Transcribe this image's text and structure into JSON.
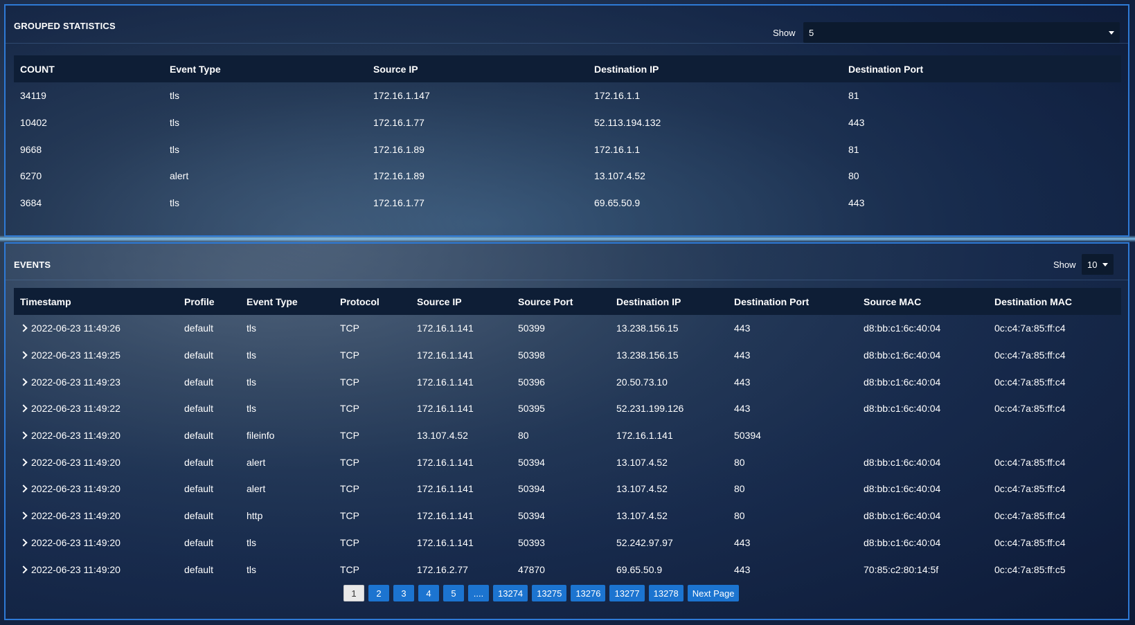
{
  "stats": {
    "title": "GROUPED STATISTICS",
    "show_label": "Show",
    "show_value": "5",
    "columns": [
      "COUNT",
      "Event Type",
      "Source IP",
      "Destination IP",
      "Destination Port"
    ],
    "rows": [
      [
        "34119",
        "tls",
        "172.16.1.147",
        "172.16.1.1",
        "81"
      ],
      [
        "10402",
        "tls",
        "172.16.1.77",
        "52.113.194.132",
        "443"
      ],
      [
        "9668",
        "tls",
        "172.16.1.89",
        "172.16.1.1",
        "81"
      ],
      [
        "6270",
        "alert",
        "172.16.1.89",
        "13.107.4.52",
        "80"
      ],
      [
        "3684",
        "tls",
        "172.16.1.77",
        "69.65.50.9",
        "443"
      ]
    ]
  },
  "events": {
    "title": "EVENTS",
    "show_label": "Show",
    "show_value": "10",
    "columns": [
      "Timestamp",
      "Profile",
      "Event Type",
      "Protocol",
      "Source IP",
      "Source Port",
      "Destination IP",
      "Destination Port",
      "Source MAC",
      "Destination MAC"
    ],
    "rows": [
      [
        "2022-06-23 11:49:26",
        "default",
        "tls",
        "TCP",
        "172.16.1.141",
        "50399",
        "13.238.156.15",
        "443",
        "d8:bb:c1:6c:40:04",
        "0c:c4:7a:85:ff:c4"
      ],
      [
        "2022-06-23 11:49:25",
        "default",
        "tls",
        "TCP",
        "172.16.1.141",
        "50398",
        "13.238.156.15",
        "443",
        "d8:bb:c1:6c:40:04",
        "0c:c4:7a:85:ff:c4"
      ],
      [
        "2022-06-23 11:49:23",
        "default",
        "tls",
        "TCP",
        "172.16.1.141",
        "50396",
        "20.50.73.10",
        "443",
        "d8:bb:c1:6c:40:04",
        "0c:c4:7a:85:ff:c4"
      ],
      [
        "2022-06-23 11:49:22",
        "default",
        "tls",
        "TCP",
        "172.16.1.141",
        "50395",
        "52.231.199.126",
        "443",
        "d8:bb:c1:6c:40:04",
        "0c:c4:7a:85:ff:c4"
      ],
      [
        "2022-06-23 11:49:20",
        "default",
        "fileinfo",
        "TCP",
        "13.107.4.52",
        "80",
        "172.16.1.141",
        "50394",
        "",
        ""
      ],
      [
        "2022-06-23 11:49:20",
        "default",
        "alert",
        "TCP",
        "172.16.1.141",
        "50394",
        "13.107.4.52",
        "80",
        "d8:bb:c1:6c:40:04",
        "0c:c4:7a:85:ff:c4"
      ],
      [
        "2022-06-23 11:49:20",
        "default",
        "alert",
        "TCP",
        "172.16.1.141",
        "50394",
        "13.107.4.52",
        "80",
        "d8:bb:c1:6c:40:04",
        "0c:c4:7a:85:ff:c4"
      ],
      [
        "2022-06-23 11:49:20",
        "default",
        "http",
        "TCP",
        "172.16.1.141",
        "50394",
        "13.107.4.52",
        "80",
        "d8:bb:c1:6c:40:04",
        "0c:c4:7a:85:ff:c4"
      ],
      [
        "2022-06-23 11:49:20",
        "default",
        "tls",
        "TCP",
        "172.16.1.141",
        "50393",
        "52.242.97.97",
        "443",
        "d8:bb:c1:6c:40:04",
        "0c:c4:7a:85:ff:c4"
      ],
      [
        "2022-06-23 11:49:20",
        "default",
        "tls",
        "TCP",
        "172.16.2.77",
        "47870",
        "69.65.50.9",
        "443",
        "70:85:c2:80:14:5f",
        "0c:c4:7a:85:ff:c5"
      ]
    ]
  },
  "pagination": {
    "pages": [
      "1",
      "2",
      "3",
      "4",
      "5",
      "....",
      "13274",
      "13275",
      "13276",
      "13277",
      "13278",
      "Next Page"
    ],
    "active": "1"
  },
  "colors": {
    "accent": "#1c74d0",
    "border": "#2e7ad6",
    "header_bg": "#0e1e36"
  },
  "icons": {
    "expand": "chevron-right-icon",
    "dropdown": "caret-down-icon"
  }
}
